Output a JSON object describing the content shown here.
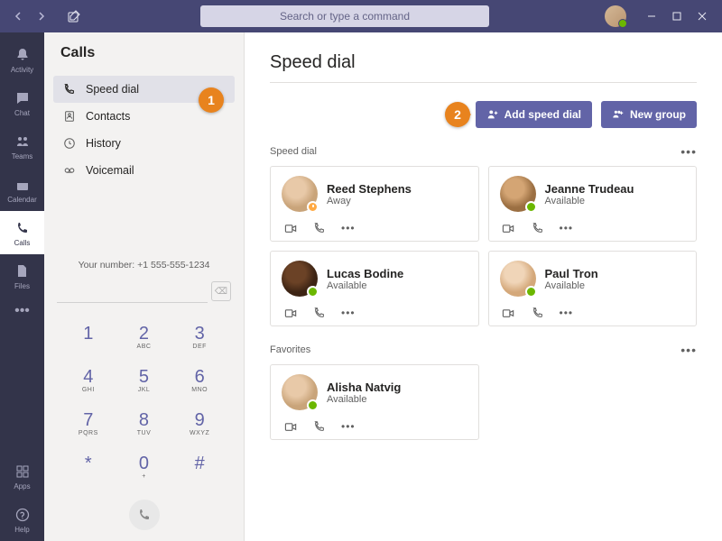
{
  "search": {
    "placeholder": "Search or type a command"
  },
  "rail": {
    "items": [
      {
        "label": "Activity"
      },
      {
        "label": "Chat"
      },
      {
        "label": "Teams"
      },
      {
        "label": "Calendar"
      },
      {
        "label": "Calls"
      },
      {
        "label": "Files"
      }
    ],
    "bottom": [
      {
        "label": "Apps"
      },
      {
        "label": "Help"
      }
    ]
  },
  "panel": {
    "title": "Calls",
    "nav": [
      {
        "label": "Speed dial"
      },
      {
        "label": "Contacts"
      },
      {
        "label": "History"
      },
      {
        "label": "Voicemail"
      }
    ],
    "your_number_label": "Your number: +1 555-555-1234"
  },
  "dialpad": {
    "keys": [
      {
        "d": "1",
        "l": ""
      },
      {
        "d": "2",
        "l": "ABC"
      },
      {
        "d": "3",
        "l": "DEF"
      },
      {
        "d": "4",
        "l": "GHI"
      },
      {
        "d": "5",
        "l": "JKL"
      },
      {
        "d": "6",
        "l": "MNO"
      },
      {
        "d": "7",
        "l": "PQRS"
      },
      {
        "d": "8",
        "l": "TUV"
      },
      {
        "d": "9",
        "l": "WXYZ"
      },
      {
        "d": "*",
        "l": ""
      },
      {
        "d": "0",
        "l": "+"
      },
      {
        "d": "#",
        "l": ""
      }
    ]
  },
  "main": {
    "title": "Speed dial",
    "add_speed_dial": "Add speed dial",
    "new_group": "New group",
    "sections": [
      {
        "title": "Speed dial",
        "contacts": [
          {
            "name": "Reed Stephens",
            "status": "Away",
            "presence": "away"
          },
          {
            "name": "Jeanne Trudeau",
            "status": "Available",
            "presence": "available"
          },
          {
            "name": "Lucas Bodine",
            "status": "Available",
            "presence": "available"
          },
          {
            "name": "Paul Tron",
            "status": "Available",
            "presence": "available"
          }
        ]
      },
      {
        "title": "Favorites",
        "contacts": [
          {
            "name": "Alisha Natvig",
            "status": "Available",
            "presence": "available"
          }
        ]
      }
    ]
  },
  "callouts": {
    "c1": "1",
    "c2": "2"
  }
}
